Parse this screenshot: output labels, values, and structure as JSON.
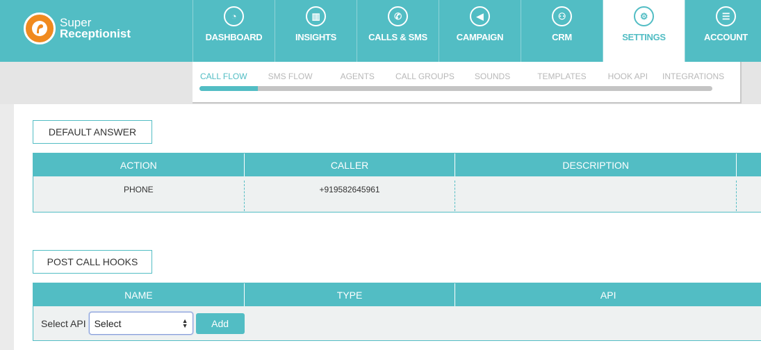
{
  "brand": {
    "line1": "Super",
    "line2": "Receptionist",
    "color": "#52bdc4",
    "logo_color": "#f08a1f"
  },
  "nav": [
    {
      "label": "DASHBOARD",
      "icon": "dashboard-gauge-icon",
      "glyph": "◔",
      "active": false
    },
    {
      "label": "INSIGHTS",
      "icon": "bar-chart-icon",
      "glyph": "▥",
      "active": false
    },
    {
      "label": "CALLS & SMS",
      "icon": "phone-icon",
      "glyph": "✆",
      "active": false
    },
    {
      "label": "CAMPAIGN",
      "icon": "megaphone-icon",
      "glyph": "◀",
      "active": false
    },
    {
      "label": "CRM",
      "icon": "users-icon",
      "glyph": "⚇",
      "active": false
    },
    {
      "label": "SETTINGS",
      "icon": "gear-icon",
      "glyph": "⚙",
      "active": true
    },
    {
      "label": "ACCOUNT",
      "icon": "list-icon",
      "glyph": "☰",
      "active": false
    }
  ],
  "subtabs": [
    {
      "label": "CALL FLOW",
      "active": true
    },
    {
      "label": "SMS FLOW",
      "active": false
    },
    {
      "label": "AGENTS",
      "active": false
    },
    {
      "label": "CALL GROUPS",
      "active": false
    },
    {
      "label": "SOUNDS",
      "active": false
    },
    {
      "label": "TEMPLATES",
      "active": false
    },
    {
      "label": "HOOK API",
      "active": false
    },
    {
      "label": "INTEGRATIONS",
      "active": false
    }
  ],
  "default_answer": {
    "button": "DEFAULT ANSWER",
    "headers": [
      "ACTION",
      "CALLER",
      "DESCRIPTION",
      ""
    ],
    "rows": [
      [
        "PHONE",
        "+919582645961",
        "",
        ""
      ]
    ]
  },
  "post_call_hooks": {
    "button": "POST CALL HOOKS",
    "headers": [
      "NAME",
      "TYPE",
      "API"
    ],
    "select_label": "Select API",
    "select_value": "Select",
    "add_label": "Add"
  }
}
